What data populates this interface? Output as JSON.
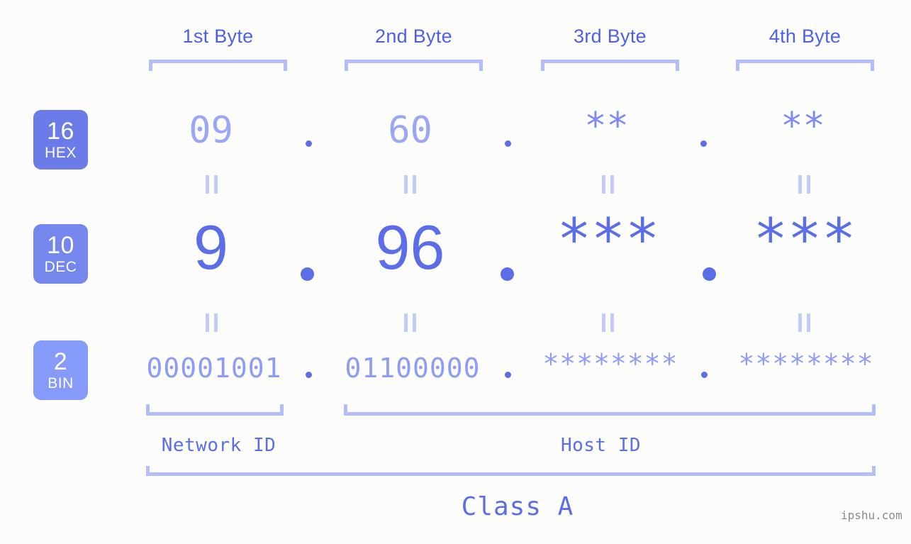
{
  "columns": [
    {
      "header": "1st Byte"
    },
    {
      "header": "2nd Byte"
    },
    {
      "header": "3rd Byte"
    },
    {
      "header": "4th Byte"
    }
  ],
  "rows": {
    "hex": {
      "badge_num": "16",
      "badge_word": "HEX",
      "values": [
        "09",
        "60",
        "**",
        "**"
      ]
    },
    "dec": {
      "badge_num": "10",
      "badge_word": "DEC",
      "values": [
        "9",
        "96",
        "***",
        "***"
      ]
    },
    "bin": {
      "badge_num": "2",
      "badge_word": "BIN",
      "values": [
        "00001001",
        "01100000",
        "********",
        "********"
      ]
    }
  },
  "separators": {
    "dot": "."
  },
  "equivalence_mark": "=",
  "sections": {
    "network_id": "Network ID",
    "host_id": "Host ID",
    "class": "Class A"
  },
  "watermark": "ipshu.com",
  "colors": {
    "background": "#fcfdfa",
    "accent": "#5b6ee8",
    "header_text": "#4e5fe8",
    "bracket": "#b3bdfb",
    "badge_hex": "#6b7ce8",
    "badge_dec": "#7586ec",
    "badge_bin": "#869afa",
    "hex_text": "#9aa6f7",
    "bin_text": "#8e9cf6",
    "equals_mark": "#c3cbfb",
    "watermark_text": "#8a8a8a"
  }
}
